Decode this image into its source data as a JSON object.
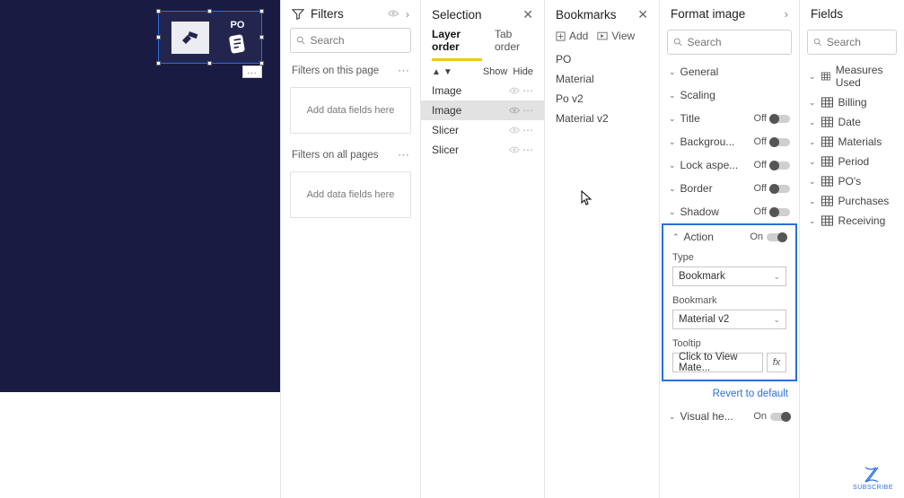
{
  "canvas": {
    "po_label": "PO",
    "visual_menu": "..."
  },
  "filters": {
    "title": "Filters",
    "search_placeholder": "Search",
    "sections": [
      {
        "label": "Filters on this page",
        "drop": "Add data fields here"
      },
      {
        "label": "Filters on all pages",
        "drop": "Add data fields here"
      }
    ]
  },
  "selection": {
    "title": "Selection",
    "tabs": {
      "layer": "Layer order",
      "tab": "Tab order"
    },
    "show": "Show",
    "hide": "Hide",
    "layers": [
      "Image",
      "Image",
      "Slicer",
      "Slicer"
    ],
    "selected_index": 1
  },
  "bookmarks": {
    "title": "Bookmarks",
    "add": "Add",
    "view": "View",
    "items": [
      "PO",
      "Material",
      "Po v2",
      "Material v2"
    ]
  },
  "format": {
    "title": "Format image",
    "search_placeholder": "Search",
    "groups": [
      {
        "label": "General",
        "toggle": null
      },
      {
        "label": "Scaling",
        "toggle": null
      },
      {
        "label": "Title",
        "toggle": "Off"
      },
      {
        "label": "Backgrou...",
        "toggle": "Off"
      },
      {
        "label": "Lock aspe...",
        "toggle": "Off"
      },
      {
        "label": "Border",
        "toggle": "Off"
      },
      {
        "label": "Shadow",
        "toggle": "Off"
      }
    ],
    "action": {
      "label": "Action",
      "on": "On",
      "type_label": "Type",
      "type_value": "Bookmark",
      "bookmark_label": "Bookmark",
      "bookmark_value": "Material v2",
      "tooltip_label": "Tooltip",
      "tooltip_value": "Click to View Mate..."
    },
    "revert": "Revert to default",
    "visual_header": {
      "label": "Visual he...",
      "toggle": "On"
    }
  },
  "fields": {
    "title": "Fields",
    "search_placeholder": "Search",
    "tables": [
      "Measures Used",
      "Billing",
      "Date",
      "Materials",
      "Period",
      "PO's",
      "Purchases",
      "Receiving"
    ]
  },
  "subscribe": "SUBSCRIBE"
}
